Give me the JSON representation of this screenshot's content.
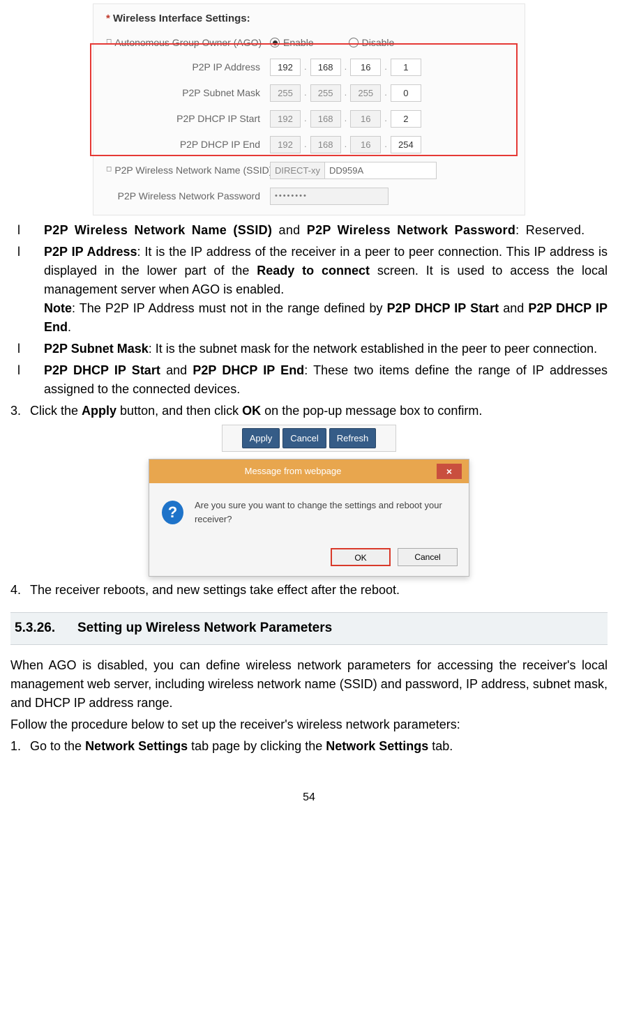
{
  "fig1": {
    "title_ast": "*",
    "title": " Wireless Interface Settings:",
    "rows": {
      "ago_label": "Autonomous Group Owner (AGO)",
      "enable": "Enable",
      "disable": "Disable",
      "p2p_ip_label": "P2P IP Address",
      "p2p_ip": [
        "192",
        "168",
        "16",
        "1"
      ],
      "p2p_mask_label": "P2P Subnet Mask",
      "p2p_mask": [
        "255",
        "255",
        "255",
        "0"
      ],
      "p2p_start_label": "P2P DHCP IP Start",
      "p2p_start": [
        "192",
        "168",
        "16",
        "2"
      ],
      "p2p_end_label": "P2P DHCP IP End",
      "p2p_end": [
        "192",
        "168",
        "16",
        "254"
      ],
      "ssid_label": "P2P Wireless Network Name (SSID)",
      "ssid_prefix": "DIRECT-xy",
      "ssid_value": "DD959A",
      "pw_label": "P2P Wireless Network Password",
      "pw_value": "••••••••"
    }
  },
  "bullets": {
    "marker": "l",
    "b1_a": "P2P Wireless Network Name (SSID)",
    "b1_b": " and ",
    "b1_c": "P2P Wireless Network Password",
    "b1_d": ": Reserved.",
    "b2_a": "P2P IP Address",
    "b2_b": ": It is the IP address of the receiver in a peer to peer connection. This IP address is displayed in the lower part of the ",
    "b2_c": "Ready to connect",
    "b2_d": " screen. It is used to access the local management server when AGO is enabled.",
    "b2_note_a": "Note",
    "b2_note_b": ": The P2P IP Address must not in the range defined by ",
    "b2_note_c": "P2P DHCP IP Start",
    "b2_note_d": " and ",
    "b2_note_e": "P2P DHCP IP End",
    "b2_note_f": ".",
    "b3_a": "P2P Subnet Mask",
    "b3_b": ": It is the subnet mask for the network established in the peer to peer connection.",
    "b4_a": "P2P DHCP IP Start",
    "b4_b": " and ",
    "b4_c": "P2P DHCP IP End",
    "b4_d": ": These two items define the range of IP addresses assigned to the connected devices."
  },
  "num3": {
    "n": "3.",
    "a": "Click the ",
    "b": "Apply",
    "c": " button, and then click ",
    "d": "OK",
    "e": " on the pop-up message box to confirm."
  },
  "fig2": {
    "apply": "Apply",
    "cancel": "Cancel",
    "refresh": "Refresh",
    "dlg_title": "Message from webpage",
    "dlg_close": "×",
    "dlg_msg": "Are you sure you want to change the settings and reboot your receiver?",
    "ok": "OK",
    "cancel2": "Cancel",
    "q": "?"
  },
  "num4": {
    "n": "4.",
    "text": "The receiver reboots, and new settings take effect after the reboot."
  },
  "section": {
    "num": "5.3.26.",
    "title": "Setting up Wireless Network Parameters"
  },
  "para1": "When AGO is disabled, you can define wireless network parameters for accessing the receiver's local management web server, including wireless network name (SSID) and password, IP address, subnet mask, and DHCP IP address range.",
  "para2": "Follow the procedure below to set up the receiver's wireless network parameters:",
  "num1": {
    "n": "1.",
    "a": "Go to the ",
    "b": "Network Settings",
    "c": " tab page by clicking the ",
    "d": "Network Settings",
    "e": " tab."
  },
  "pagenum": "54"
}
